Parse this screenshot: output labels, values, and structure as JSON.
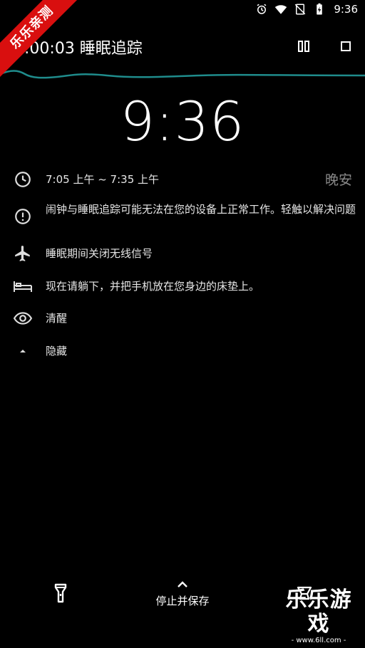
{
  "status_bar": {
    "time": "9:36",
    "icons": [
      "alarm-icon",
      "wifi-icon",
      "no-sim-icon",
      "battery-charging-icon"
    ]
  },
  "watermark": {
    "ribbon_text": "乐乐亲测",
    "brand_title": "乐乐游戏",
    "brand_url": "- www.6ll.com -"
  },
  "toolbar": {
    "title": "0:00:03 睡眠追踪",
    "icons": [
      "pause-icon",
      "stop-icon"
    ]
  },
  "clock": {
    "time": "9:36"
  },
  "rows": {
    "schedule": {
      "text": "7:05 上午 ~ 7:35 上午",
      "action": "晚安",
      "icon": "clock-icon"
    },
    "warning": {
      "text": "闹钟与睡眠追踪可能无法在您的设备上正常工作。轻触以解决问题",
      "icon": "alert-circle-icon"
    },
    "airplane": {
      "text": "睡眠期间关闭无线信号",
      "icon": "airplane-icon"
    },
    "bed": {
      "text": "现在请躺下，并把手机放在您身边的床垫上。",
      "icon": "bed-icon"
    },
    "awake": {
      "text": "清醒",
      "icon": "eye-icon"
    },
    "hide": {
      "text": "隐藏",
      "icon": "caret-up-icon"
    }
  },
  "bottom": {
    "stop_save_label": "停止并保存",
    "left_icon": "flashlight-icon",
    "right_icon": "lamp-icon"
  },
  "colors": {
    "background": "#000000",
    "text": "#e6e6e6",
    "muted": "#8a8a8a",
    "wave": "#1f8c8c",
    "ribbon": "#d90f0f"
  }
}
